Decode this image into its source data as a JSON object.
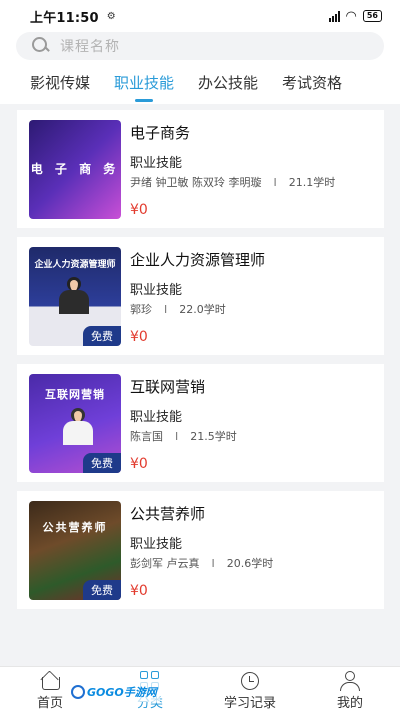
{
  "status_bar": {
    "time": "上午11:50",
    "battery": "56"
  },
  "search": {
    "placeholder": "课程名称"
  },
  "tabs": [
    {
      "label": "影视传媒",
      "active": false
    },
    {
      "label": "职业技能",
      "active": true
    },
    {
      "label": "办公技能",
      "active": false
    },
    {
      "label": "考试资格",
      "active": false
    }
  ],
  "courses": [
    {
      "title": "电子商务",
      "category": "职业技能",
      "teachers": "尹绪 钟卫敏 陈双玲 李明璇",
      "hours": "21.1学时",
      "price": "¥0",
      "thumb_text": "电 子 商 务"
    },
    {
      "title": "企业人力资源管理师",
      "category": "职业技能",
      "teachers": "郭珍",
      "hours": "22.0学时",
      "price": "¥0",
      "thumb_text": "企业人力资源管理师",
      "thumb_badge": "免费"
    },
    {
      "title": "互联网营销",
      "category": "职业技能",
      "teachers": "陈言国",
      "hours": "21.5学时",
      "price": "¥0",
      "thumb_text": "互联网营销",
      "thumb_badge": "免费"
    },
    {
      "title": "公共营养师",
      "category": "职业技能",
      "teachers": "彭剑军 卢云真",
      "hours": "20.6学时",
      "price": "¥0",
      "thumb_text": "公共营养师",
      "thumb_badge": "免费"
    }
  ],
  "bottom_nav": [
    {
      "label": "首页",
      "icon": "home-icon"
    },
    {
      "label": "分类",
      "icon": "grid-icon",
      "active": true
    },
    {
      "label": "学习记录",
      "icon": "clock-icon"
    },
    {
      "label": "我的",
      "icon": "user-icon"
    }
  ],
  "watermark": "GOGO手游网",
  "colors": {
    "accent": "#2a9bd8",
    "price": "#e23b2e",
    "background": "#f2f3f5"
  }
}
